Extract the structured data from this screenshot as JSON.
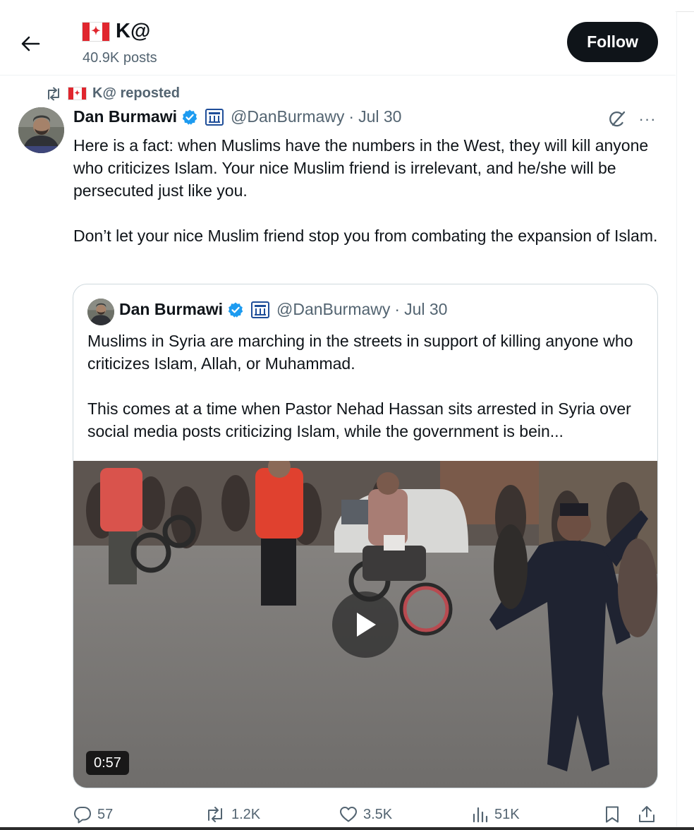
{
  "header": {
    "display_name": "K@",
    "post_count": "40.9K posts",
    "follow_label": "Follow"
  },
  "repost_line": {
    "text": "K@ reposted"
  },
  "tweet": {
    "author_name": "Dan Burmawi",
    "handle": "@DanBurmawy",
    "separator": "·",
    "date": "Jul 30",
    "paragraphs": [
      "Here is a fact: when Muslims have the numbers in the West, they will kill anyone who criticizes Islam. Your nice Muslim friend is irrelevant, and he/she will be persecuted just like you.",
      "Don’t let your nice Muslim friend stop you from combating the expansion of Islam."
    ],
    "more_label": "···"
  },
  "quote": {
    "author_name": "Dan Burmawi",
    "handle": "@DanBurmawy",
    "separator": "·",
    "date": "Jul 30",
    "paragraphs": [
      "Muslims in Syria are marching in the streets in support of killing anyone who criticizes Islam, Allah, or Muhammad.",
      "This comes at a time when Pastor Nehad Hassan sits arrested in Syria over social media posts criticizing Islam, while the government is bein..."
    ],
    "video_duration": "0:57"
  },
  "actions": {
    "replies": "57",
    "reposts": "1.2K",
    "likes": "3.5K",
    "views": "51K"
  },
  "icons": {
    "back": "arrow-left-icon",
    "flag": "canada-flag-icon",
    "repost": "repost-icon",
    "verified": "verified-badge-icon",
    "affiliate": "affiliate-building-icon",
    "grok": "grok-icon",
    "more": "more-dots-icon",
    "play": "play-icon",
    "reply": "reply-icon",
    "like": "heart-icon",
    "views": "views-chart-icon",
    "bookmark": "bookmark-icon",
    "share": "share-icon"
  },
  "colors": {
    "verified_blue": "#1d9bf0",
    "text_primary": "#0f1419",
    "text_secondary": "#536471",
    "follow_bg": "#0f1419",
    "flag_red": "#e0262e",
    "border": "#cfd9de"
  }
}
